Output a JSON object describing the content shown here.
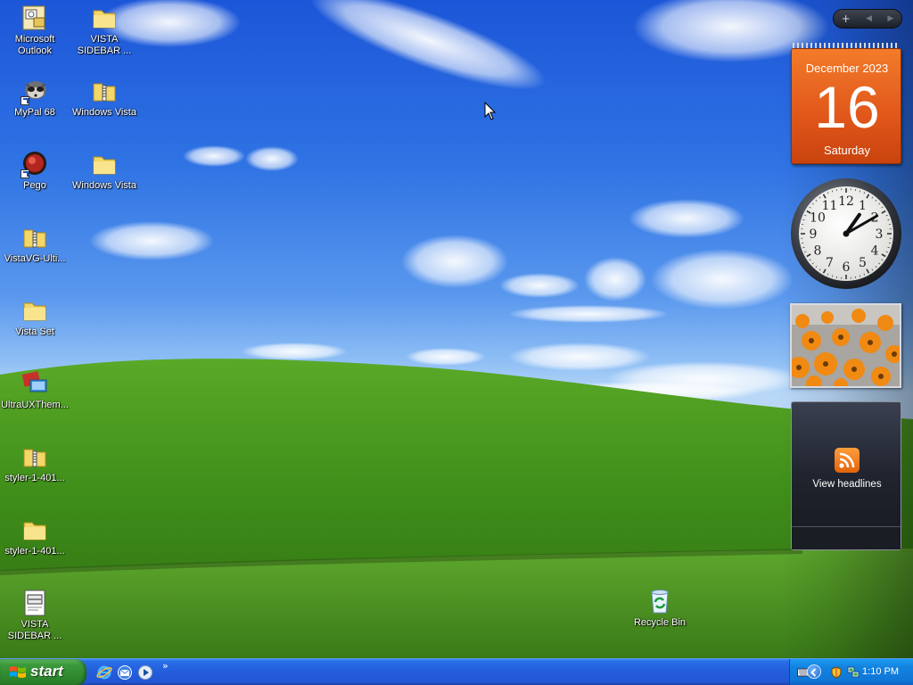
{
  "desktop_icons": [
    {
      "label": "Microsoft Outlook",
      "icon": "outlook-icon"
    },
    {
      "label": "VISTA SIDEBAR ...",
      "icon": "folder-icon"
    },
    {
      "label": "MyPal 68",
      "icon": "raccoon-browser-icon"
    },
    {
      "label": "Windows Vista",
      "icon": "zip-folder-icon"
    },
    {
      "label": "Pego",
      "icon": "pego-icon"
    },
    {
      "label": "Windows Vista",
      "icon": "folder-icon"
    },
    {
      "label": "VistaVG-Ulti...",
      "icon": "zip-folder-icon"
    },
    {
      "label": "Vista Set",
      "icon": "folder-icon"
    },
    {
      "label": "UltraUXThem...",
      "icon": "theme-patcher-icon"
    },
    {
      "label": "styler-1-401...",
      "icon": "zip-folder-icon"
    },
    {
      "label": "styler-1-401...",
      "icon": "folder-icon"
    },
    {
      "label": "VISTA SIDEBAR ...",
      "icon": "document-icon"
    },
    {
      "label": "Recycle Bin",
      "icon": "recycle-bin-icon"
    }
  ],
  "sidebar": {
    "controls": {
      "add": "+",
      "prev": "◀",
      "next": "▶"
    },
    "calendar": {
      "month_year": "December 2023",
      "day": "16",
      "weekday": "Saturday"
    },
    "clock": {
      "hour": 1,
      "minute": 10,
      "numerals": [
        "12",
        "1",
        "2",
        "3",
        "4",
        "5",
        "6",
        "7",
        "8",
        "9",
        "10",
        "11"
      ]
    },
    "slideshow": {
      "subject": "orange flowers"
    },
    "feed": {
      "label": "View headlines",
      "icon": "rss-icon"
    }
  },
  "taskbar": {
    "start_label": "start",
    "quick_launch": [
      "internet-explorer-icon",
      "outlook-express-icon",
      "media-player-icon"
    ],
    "more_chevron": "»",
    "tray": {
      "time": "1:10 PM",
      "icons": [
        "keyboard-icon",
        "show-hidden-icon",
        "security-shield-icon",
        "network-icon"
      ]
    }
  },
  "colors": {
    "taskbar_blue": "#245edb",
    "start_green": "#3c9a3c",
    "calendar_orange": "#e0561a",
    "tray_blue": "#0f76d6"
  }
}
